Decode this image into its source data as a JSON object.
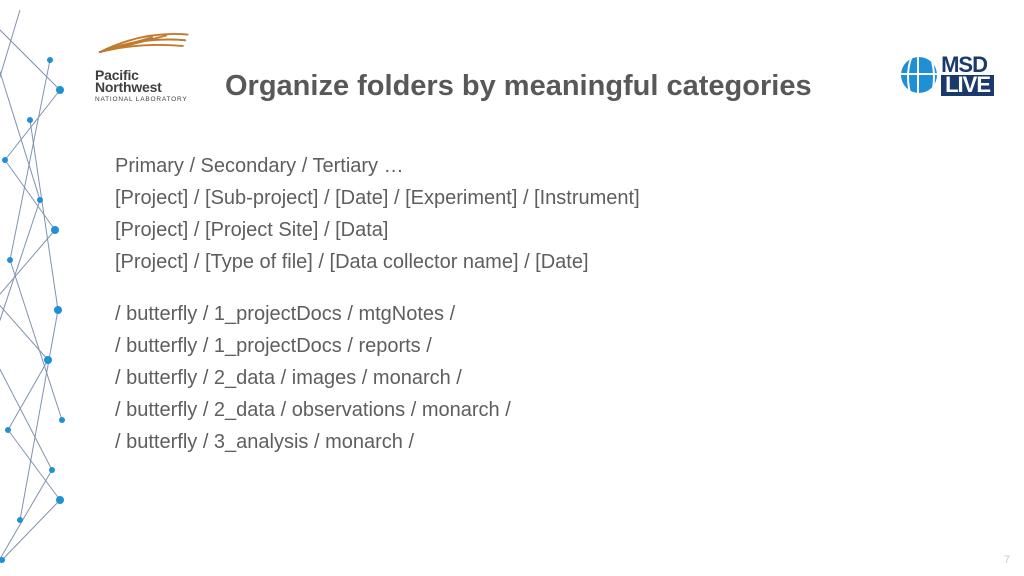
{
  "brand_left": {
    "line1": "Pacific",
    "line2": "Northwest",
    "sub": "NATIONAL LABORATORY"
  },
  "brand_right": {
    "top": "MSD",
    "bottom": "LIVE"
  },
  "title": "Organize folders by meaningful categories",
  "schemes": [
    "Primary / Secondary / Tertiary …",
    "[Project] / [Sub-project] / [Date] / [Experiment] / [Instrument]",
    "[Project] / [Project Site] / [Data]",
    "[Project] / [Type of file] / [Data collector name] / [Date]"
  ],
  "examples": [
    "/ butterfly / 1_projectDocs / mtgNotes /",
    "/ butterfly / 1_projectDocs / reports /",
    "/ butterfly / 2_data / images / monarch /",
    "/ butterfly / 2_data / observations / monarch /",
    "/ butterfly / 3_analysis / monarch /"
  ],
  "page_number": "7"
}
